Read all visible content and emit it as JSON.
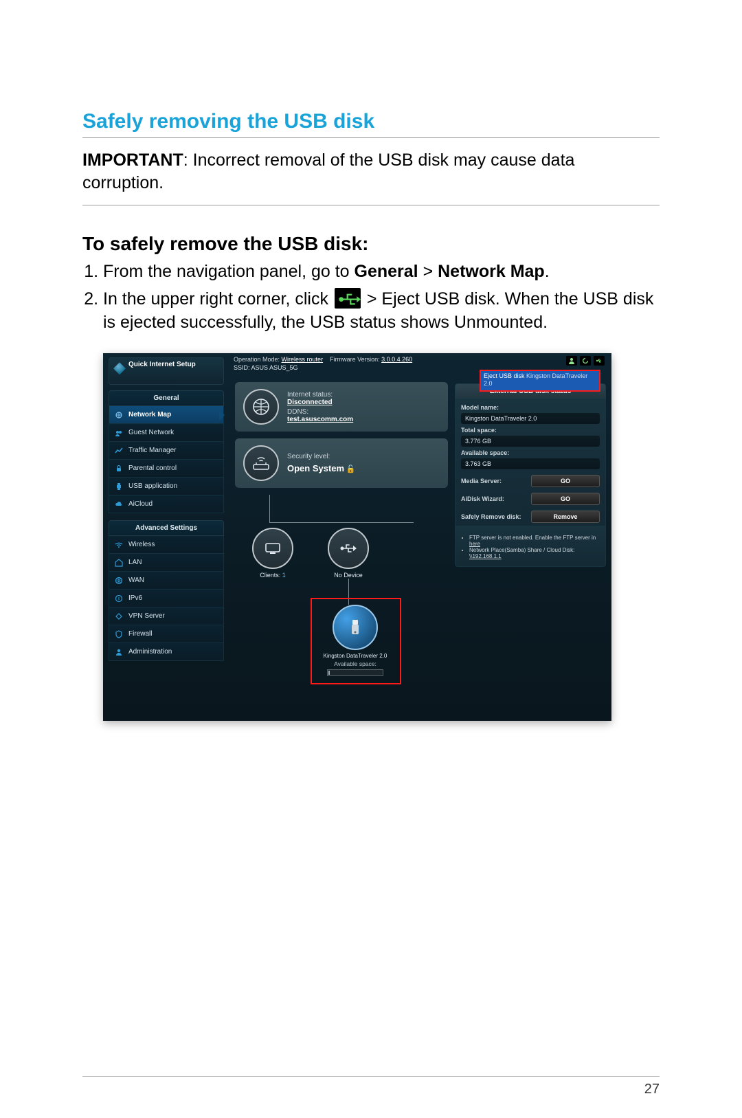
{
  "doc": {
    "section_title": "Safely removing the USB disk",
    "important_label": "IMPORTANT",
    "important_text": ":  Incorrect removal of the USB disk may cause data corruption.",
    "subhead": "To safely remove the USB disk:",
    "step1_a": "From the navigation panel, go to ",
    "step1_b1": "General",
    "step1_sep": " > ",
    "step1_b2": "Network Map",
    "step1_c": ".",
    "step2_a": "In the upper right corner, click ",
    "step2_b": " > Eject USB disk. When the USB disk is ejected successfully, the USB status shows Unmounted.",
    "page_number": "27"
  },
  "shot": {
    "header": {
      "opmode_k": "Operation Mode: ",
      "opmode_v": "Wireless router",
      "fw_k": "Firmware Version: ",
      "fw_v": "3.0.0.4.260",
      "ssid_k": "SSID: ",
      "ssid_v": "ASUS  ASUS_5G"
    },
    "qis": "Quick Internet Setup",
    "nav_general": "General",
    "nav_items1": [
      "Network Map",
      "Guest Network",
      "Traffic Manager",
      "Parental control",
      "USB application",
      "AiCloud"
    ],
    "nav_advanced": "Advanced Settings",
    "nav_items2": [
      "Wireless",
      "LAN",
      "WAN",
      "IPv6",
      "VPN Server",
      "Firewall",
      "Administration"
    ],
    "center": {
      "inet_k": "Internet status:",
      "inet_v": "Disconnected",
      "ddns_k": "DDNS:",
      "ddns_v": "test.asuscomm.com",
      "sec_k": "Security level:",
      "sec_v": "Open System",
      "clients_k": "Clients:",
      "clients_v": "1",
      "nodev": "No Device",
      "usb_name": "Kingston DataTraveler 2.0",
      "avail_k": "Available space:"
    },
    "eject": {
      "line1": "Eject USB disk ",
      "dev": "Kingston DataTraveler 2.0"
    },
    "rpanel": {
      "title": "External USB disk status",
      "model_k": "Model name:",
      "model_v": "Kingston DataTraveler 2.0",
      "total_k": "Total space:",
      "total_v": "3.776 GB",
      "avail_k": "Available space:",
      "avail_v": "3.763 GB",
      "media_k": "Media Server:",
      "aidisk_k": "AiDisk Wizard:",
      "safe_k": "Safely Remove disk:",
      "go": "GO",
      "remove": "Remove",
      "note1a": "FTP server is not enabled. Enable the FTP server in ",
      "note1b": "here",
      "note2": "Network Place(Samba) Share / Cloud Disk:",
      "note3": "\\\\192.168.1.1"
    }
  }
}
